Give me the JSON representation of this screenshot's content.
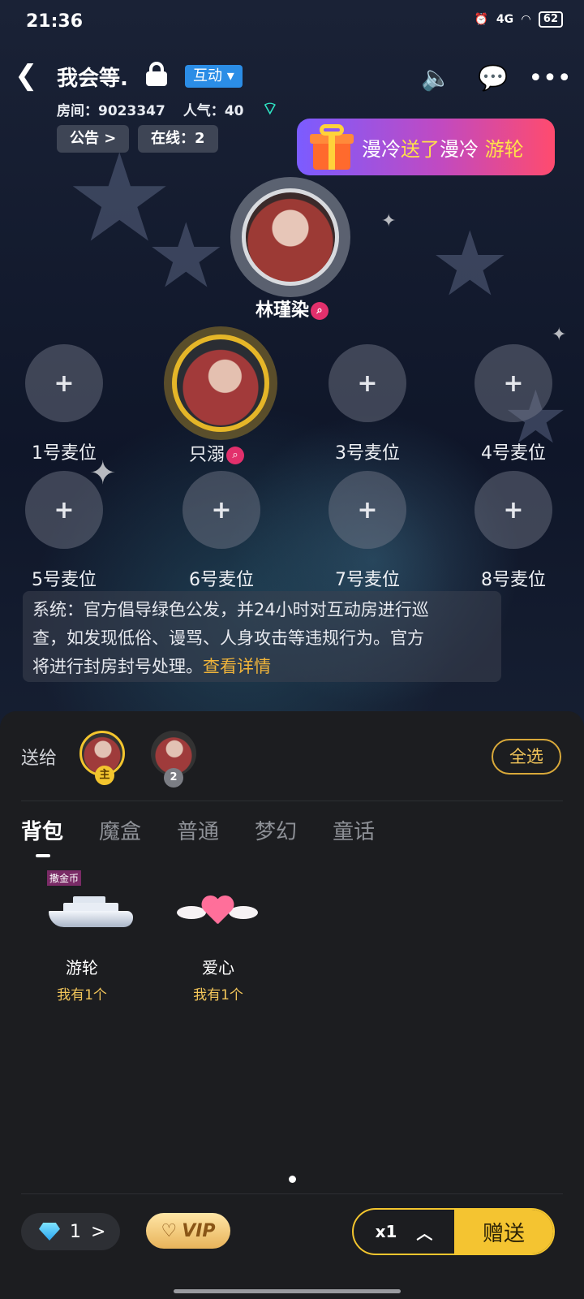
{
  "status_bar": {
    "time": "21:36",
    "network": "4G",
    "battery": "62"
  },
  "header": {
    "title": "我会等.",
    "mode_tag": "互动"
  },
  "room": {
    "room_label": "房间：",
    "room_id": "9023347",
    "popularity_label": "人气：",
    "popularity": "40",
    "notice_label": "公告",
    "online_label": "在线：",
    "online_count": "2"
  },
  "banner": {
    "sender": "漫冷",
    "action": "送了",
    "receiver": "漫冷",
    "gift": "游轮"
  },
  "host": {
    "name": "林瑾染"
  },
  "seats": [
    {
      "label": "1号麦位"
    },
    {
      "label": "只溺",
      "occupied": true
    },
    {
      "label": "3号麦位"
    },
    {
      "label": "4号麦位"
    },
    {
      "label": "5号麦位"
    },
    {
      "label": "6号麦位"
    },
    {
      "label": "7号麦位"
    },
    {
      "label": "8号麦位"
    }
  ],
  "notice": {
    "line1": "系统：官方倡导绿色公发，并24小时对互动房进行巡",
    "line2": "查，如发现低俗、谩骂、人身攻击等违规行为。官方",
    "line3": "将进行封房封号处理。",
    "link": "查看详情"
  },
  "gift_panel": {
    "send_to_label": "送给",
    "recipients": [
      {
        "tag": "主",
        "selected": true
      },
      {
        "tag": "2",
        "selected": false
      }
    ],
    "select_all": "全选",
    "tabs": [
      "背包",
      "魔盒",
      "普通",
      "梦幻",
      "童话"
    ],
    "active_tab": "背包",
    "items": [
      {
        "tag": "撒金币",
        "name": "游轮",
        "owned": "我有1个"
      },
      {
        "name": "爱心",
        "owned": "我有1个"
      }
    ]
  },
  "bottom_bar": {
    "diamonds": "1",
    "vip_label": "VIP",
    "quantity": "x1",
    "send_label": "赠送"
  },
  "colors": {
    "accent": "#f4c431",
    "mode_tag": "#2b8de6",
    "link": "#f0b43a"
  }
}
